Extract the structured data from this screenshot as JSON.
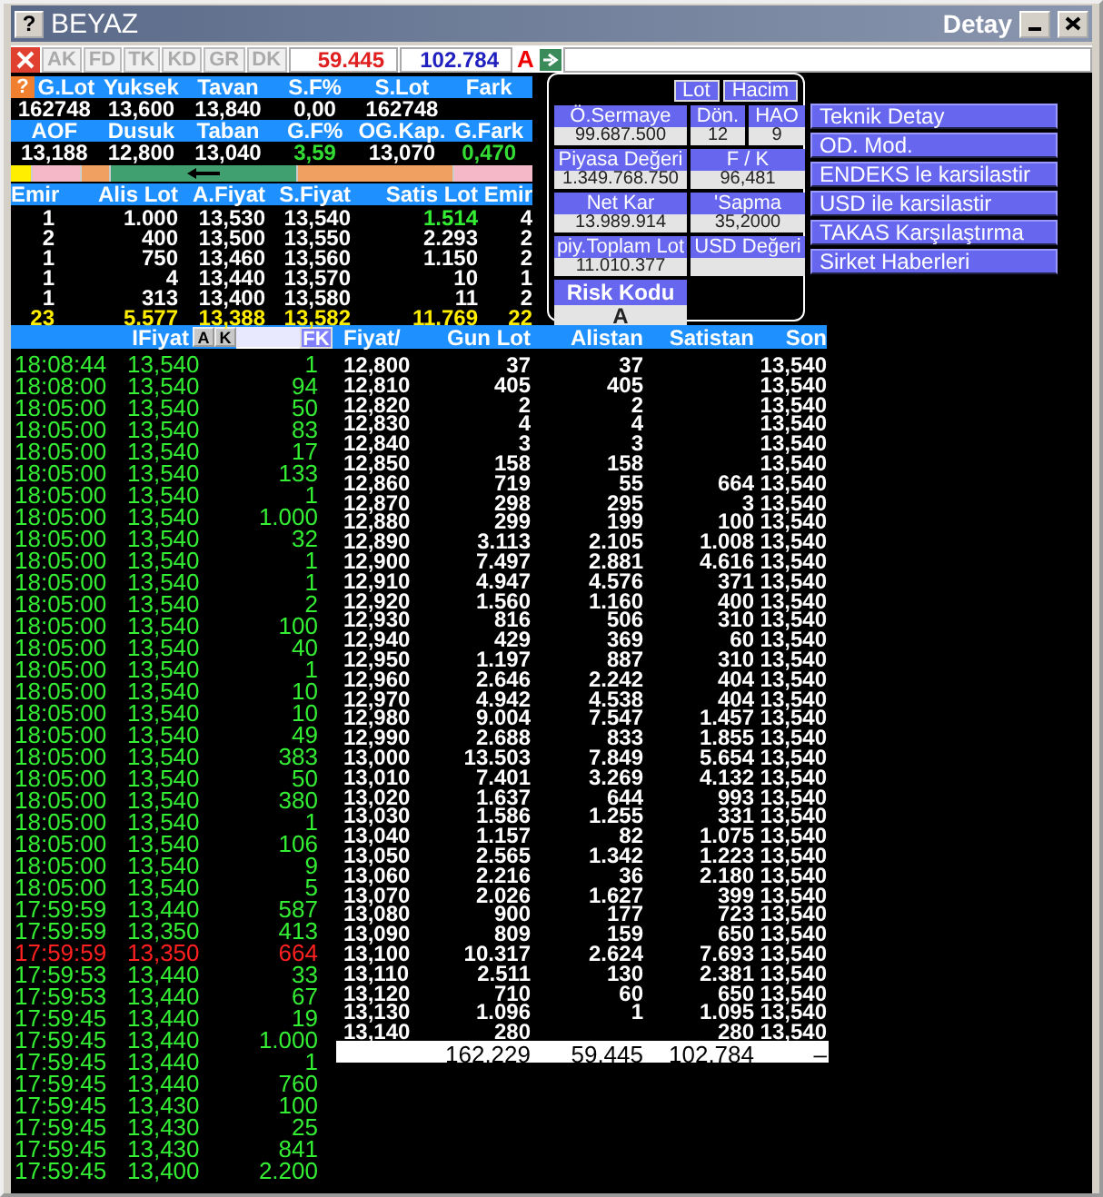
{
  "window": {
    "help": "?",
    "title": "BEYAZ",
    "subtitle": "Detay"
  },
  "stats_help": "?",
  "toolbar": {
    "tabs": [
      "AK",
      "FD",
      "TK",
      "KD",
      "GR",
      "DK"
    ],
    "bid_total": "59.445",
    "ask_total": "102.784",
    "mode": "A"
  },
  "stats": [
    {
      "label": "G.Lot",
      "value": "162748",
      "up": false
    },
    {
      "label": "Yuksek",
      "value": "13,600",
      "up": false
    },
    {
      "label": "Tavan",
      "value": "13,840",
      "up": false
    },
    {
      "label": "S.F%",
      "value": "0,00",
      "up": false
    },
    {
      "label": "S.Lot",
      "value": "162748",
      "up": false
    },
    {
      "label": "Fark"
    },
    {
      "label": "AOF",
      "value": "13,188",
      "up": false
    },
    {
      "label": "Dusuk",
      "value": "12,800",
      "up": false
    },
    {
      "label": "Taban",
      "value": "13,040",
      "up": false
    },
    {
      "label": "G.F%",
      "value": "3,59",
      "up": true
    },
    {
      "label": "OG.Kap.",
      "value": "13,070",
      "up": false
    },
    {
      "label": "G.Fark",
      "value": "0,470",
      "up": true
    }
  ],
  "range_bar": [
    {
      "color": "#ffee00",
      "kind": "plain"
    },
    {
      "color": "#f4b8c8",
      "kind": "plain"
    },
    {
      "color": "#f0a060",
      "kind": "plain"
    },
    {
      "color": "#40a070",
      "kind": "arrow"
    },
    {
      "color": "#f0a060",
      "kind": "plain"
    },
    {
      "color": "#f4b8c8",
      "kind": "plain"
    }
  ],
  "depth": {
    "columns": [
      "Emir",
      "Alis Lot",
      "A.Fiyat",
      "S.Fiyat",
      "Satis Lot",
      "Emir"
    ],
    "rows": [
      {
        "cells": [
          "1",
          "1.000",
          "13,530",
          "13,540",
          "1.514",
          "4"
        ],
        "ask_changed": true
      },
      {
        "cells": [
          "2",
          "400",
          "13,500",
          "13,550",
          "2.293",
          "2"
        ],
        "ask_changed": false
      },
      {
        "cells": [
          "1",
          "750",
          "13,460",
          "13,560",
          "1.150",
          "2"
        ],
        "ask_changed": false
      },
      {
        "cells": [
          "1",
          "4",
          "13,440",
          "13,570",
          "10",
          "1"
        ],
        "ask_changed": false
      },
      {
        "cells": [
          "1",
          "313",
          "13,400",
          "13,580",
          "11",
          "2"
        ],
        "ask_changed": false
      }
    ],
    "totals": [
      "23",
      "5.577",
      "13,388",
      "13,582",
      "11.769",
      "22"
    ]
  },
  "info": {
    "buttons": [
      "Lot",
      "Hacim"
    ],
    "fields": [
      {
        "label": "Ö.Sermaye",
        "value": "99.687.500",
        "kind": "wide"
      },
      {
        "label": "Dön.",
        "value": "12",
        "kind": "narrow"
      },
      {
        "label": "HAO",
        "value": "9",
        "kind": "narrow"
      },
      {
        "label": "Piyasa Değeri",
        "value": "1.349.768.750",
        "kind": "wide"
      },
      {
        "label": "F / K",
        "value": "96,481",
        "kind": "pair"
      },
      {
        "label": "Net Kar",
        "value": "13.989.914",
        "kind": "wide"
      },
      {
        "label": "'Sapma",
        "value": "35,2000",
        "kind": "pair"
      },
      {
        "label": "piy.Toplam Lot",
        "value": "11.010.377",
        "kind": "wide"
      },
      {
        "label": "USD Değeri",
        "kind": "pair"
      },
      {
        "label": "Risk Kodu",
        "value": "A",
        "kind": "risk"
      }
    ]
  },
  "actions": [
    "Teknik Detay",
    "OD. Mod.",
    "ENDEKS le karsilastir",
    "USD ile karsilastir",
    "TAKAS Karşılaştırma",
    "Sirket Haberleri"
  ],
  "trades": {
    "header": "IFiyat",
    "buttons": [
      "A",
      "K"
    ],
    "filter": "FK",
    "rows": [
      {
        "time": "18:08:44",
        "price": "13,540",
        "lot": "1",
        "highlighted": false
      },
      {
        "time": "18:08:00",
        "price": "13,540",
        "lot": "94",
        "highlighted": false
      },
      {
        "time": "18:05:00",
        "price": "13,540",
        "lot": "50",
        "highlighted": false
      },
      {
        "time": "18:05:00",
        "price": "13,540",
        "lot": "83",
        "highlighted": false
      },
      {
        "time": "18:05:00",
        "price": "13,540",
        "lot": "17",
        "highlighted": false
      },
      {
        "time": "18:05:00",
        "price": "13,540",
        "lot": "133",
        "highlighted": false
      },
      {
        "time": "18:05:00",
        "price": "13,540",
        "lot": "1",
        "highlighted": false
      },
      {
        "time": "18:05:00",
        "price": "13,540",
        "lot": "1.000",
        "highlighted": false
      },
      {
        "time": "18:05:00",
        "price": "13,540",
        "lot": "32",
        "highlighted": false
      },
      {
        "time": "18:05:00",
        "price": "13,540",
        "lot": "1",
        "highlighted": false
      },
      {
        "time": "18:05:00",
        "price": "13,540",
        "lot": "1",
        "highlighted": false
      },
      {
        "time": "18:05:00",
        "price": "13,540",
        "lot": "2",
        "highlighted": false
      },
      {
        "time": "18:05:00",
        "price": "13,540",
        "lot": "100",
        "highlighted": false
      },
      {
        "time": "18:05:00",
        "price": "13,540",
        "lot": "40",
        "highlighted": false
      },
      {
        "time": "18:05:00",
        "price": "13,540",
        "lot": "1",
        "highlighted": false
      },
      {
        "time": "18:05:00",
        "price": "13,540",
        "lot": "10",
        "highlighted": false
      },
      {
        "time": "18:05:00",
        "price": "13,540",
        "lot": "10",
        "highlighted": false
      },
      {
        "time": "18:05:00",
        "price": "13,540",
        "lot": "49",
        "highlighted": false
      },
      {
        "time": "18:05:00",
        "price": "13,540",
        "lot": "383",
        "highlighted": false
      },
      {
        "time": "18:05:00",
        "price": "13,540",
        "lot": "50",
        "highlighted": false
      },
      {
        "time": "18:05:00",
        "price": "13,540",
        "lot": "380",
        "highlighted": false
      },
      {
        "time": "18:05:00",
        "price": "13,540",
        "lot": "1",
        "highlighted": false
      },
      {
        "time": "18:05:00",
        "price": "13,540",
        "lot": "106",
        "highlighted": false
      },
      {
        "time": "18:05:00",
        "price": "13,540",
        "lot": "9",
        "highlighted": false
      },
      {
        "time": "18:05:00",
        "price": "13,540",
        "lot": "5",
        "highlighted": false
      },
      {
        "time": "17:59:59",
        "price": "13,440",
        "lot": "587",
        "highlighted": false
      },
      {
        "time": "17:59:59",
        "price": "13,350",
        "lot": "413",
        "highlighted": false
      },
      {
        "time": "17:59:59",
        "price": "13,350",
        "lot": "664",
        "highlighted": true
      },
      {
        "time": "17:59:53",
        "price": "13,440",
        "lot": "33",
        "highlighted": false
      },
      {
        "time": "17:59:53",
        "price": "13,440",
        "lot": "67",
        "highlighted": false
      },
      {
        "time": "17:59:45",
        "price": "13,440",
        "lot": "19",
        "highlighted": false
      },
      {
        "time": "17:59:45",
        "price": "13,440",
        "lot": "1.000",
        "highlighted": false
      },
      {
        "time": "17:59:45",
        "price": "13,440",
        "lot": "1",
        "highlighted": false
      },
      {
        "time": "17:59:45",
        "price": "13,440",
        "lot": "760",
        "highlighted": false
      },
      {
        "time": "17:59:45",
        "price": "13,430",
        "lot": "100",
        "highlighted": false
      },
      {
        "time": "17:59:45",
        "price": "13,430",
        "lot": "25",
        "highlighted": false
      },
      {
        "time": "17:59:45",
        "price": "13,430",
        "lot": "841",
        "highlighted": false
      },
      {
        "time": "17:59:45",
        "price": "13,400",
        "lot": "2.200",
        "highlighted": false
      }
    ]
  },
  "price_table": {
    "columns": [
      "Fiyat/",
      "Gun Lot",
      "Alistan",
      "Satistan",
      "Son"
    ],
    "rows": [
      [
        "12,800",
        "37",
        "37",
        "",
        "13,540"
      ],
      [
        "12,810",
        "405",
        "405",
        "",
        "13,540"
      ],
      [
        "12,820",
        "2",
        "2",
        "",
        "13,540"
      ],
      [
        "12,830",
        "4",
        "4",
        "",
        "13,540"
      ],
      [
        "12,840",
        "3",
        "3",
        "",
        "13,540"
      ],
      [
        "12,850",
        "158",
        "158",
        "",
        "13,540"
      ],
      [
        "12,860",
        "719",
        "55",
        "664",
        "13,540"
      ],
      [
        "12,870",
        "298",
        "295",
        "3",
        "13,540"
      ],
      [
        "12,880",
        "299",
        "199",
        "100",
        "13,540"
      ],
      [
        "12,890",
        "3.113",
        "2.105",
        "1.008",
        "13,540"
      ],
      [
        "12,900",
        "7.497",
        "2.881",
        "4.616",
        "13,540"
      ],
      [
        "12,910",
        "4.947",
        "4.576",
        "371",
        "13,540"
      ],
      [
        "12,920",
        "1.560",
        "1.160",
        "400",
        "13,540"
      ],
      [
        "12,930",
        "816",
        "506",
        "310",
        "13,540"
      ],
      [
        "12,940",
        "429",
        "369",
        "60",
        "13,540"
      ],
      [
        "12,950",
        "1.197",
        "887",
        "310",
        "13,540"
      ],
      [
        "12,960",
        "2.646",
        "2.242",
        "404",
        "13,540"
      ],
      [
        "12,970",
        "4.942",
        "4.538",
        "404",
        "13,540"
      ],
      [
        "12,980",
        "9.004",
        "7.547",
        "1.457",
        "13,540"
      ],
      [
        "12,990",
        "2.688",
        "833",
        "1.855",
        "13,540"
      ],
      [
        "13,000",
        "13.503",
        "7.849",
        "5.654",
        "13,540"
      ],
      [
        "13,010",
        "7.401",
        "3.269",
        "4.132",
        "13,540"
      ],
      [
        "13,020",
        "1.637",
        "644",
        "993",
        "13,540"
      ],
      [
        "13,030",
        "1.586",
        "1.255",
        "331",
        "13,540"
      ],
      [
        "13,040",
        "1.157",
        "82",
        "1.075",
        "13,540"
      ],
      [
        "13,050",
        "2.565",
        "1.342",
        "1.223",
        "13,540"
      ],
      [
        "13,060",
        "2.216",
        "36",
        "2.180",
        "13,540"
      ],
      [
        "13,070",
        "2.026",
        "1.627",
        "399",
        "13,540"
      ],
      [
        "13,080",
        "900",
        "177",
        "723",
        "13,540"
      ],
      [
        "13,090",
        "809",
        "159",
        "650",
        "13,540"
      ],
      [
        "13,100",
        "10.317",
        "2.624",
        "7.693",
        "13,540"
      ],
      [
        "13,110",
        "2.511",
        "130",
        "2.381",
        "13,540"
      ],
      [
        "13,120",
        "710",
        "60",
        "650",
        "13,540"
      ],
      [
        "13,130",
        "1.096",
        "1",
        "1.095",
        "13,540"
      ],
      [
        "13,140",
        "280",
        "",
        "280",
        "13,540"
      ]
    ],
    "totals": {
      "gun_lot": "162.229",
      "alistan": "59.445",
      "satistan": "102.784",
      "son": "–"
    }
  }
}
